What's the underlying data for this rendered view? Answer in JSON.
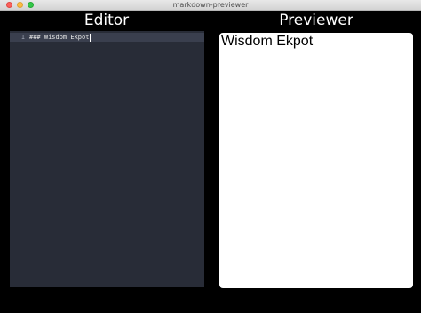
{
  "window": {
    "title": "markdown-previewer"
  },
  "editor": {
    "title": "Editor",
    "lines": [
      {
        "number": "1",
        "text": "### Wisdom Ekpot"
      }
    ]
  },
  "previewer": {
    "title": "Previewer",
    "heading": "Wisdom Ekpot"
  }
}
